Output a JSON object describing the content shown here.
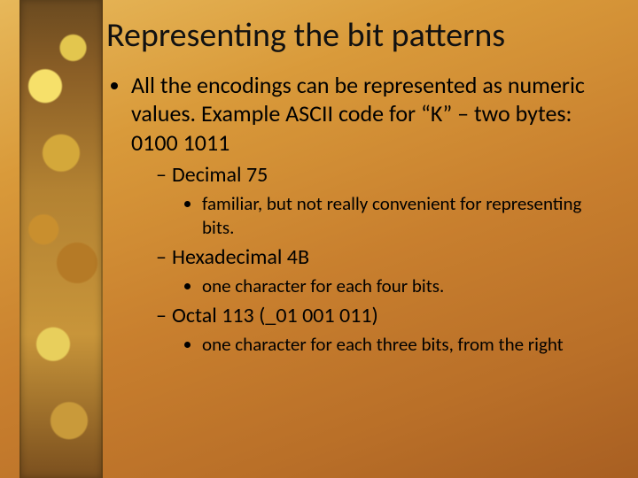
{
  "slide": {
    "title": "Representing the bit patterns",
    "bullets": [
      {
        "text": "All the encodings can be represented as numeric values.  Example ASCII code for “K” – two bytes: 0100 1011",
        "children": [
          {
            "text": "Decimal 75",
            "children": [
              {
                "text": "familiar, but not really convenient for representing bits."
              }
            ]
          },
          {
            "text": "Hexadecimal 4B",
            "children": [
              {
                "text": "one character for each four bits."
              }
            ]
          },
          {
            "text": "Octal 113   (_01 001 011)",
            "children": [
              {
                "text": "one character for each three bits, from the right"
              }
            ]
          }
        ]
      }
    ]
  }
}
